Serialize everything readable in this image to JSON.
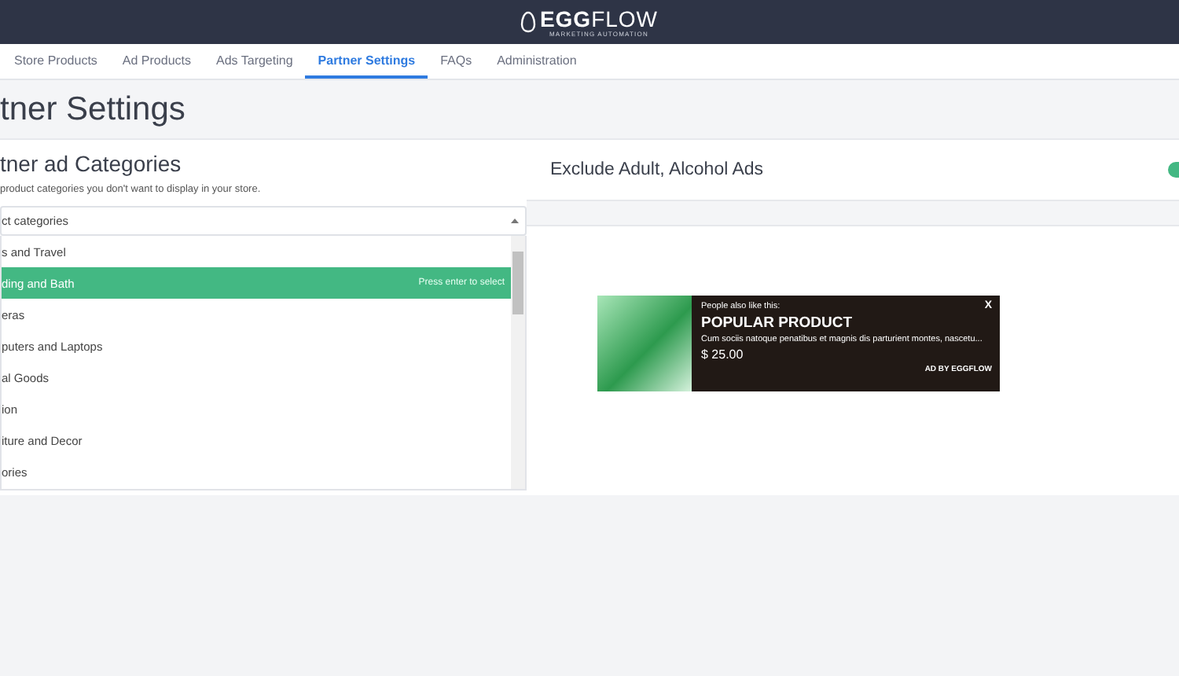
{
  "header": {
    "logo": "**EGG**FLOW",
    "tagline": "MARKETING AUTOMATION"
  },
  "tabs": [
    {
      "label": "Store Products",
      "selected": false
    },
    {
      "label": "Ad Products",
      "selected": false
    },
    {
      "label": "Ads Targeting",
      "selected": false
    },
    {
      "label": "Partner Settings",
      "selected": true
    },
    {
      "label": "FAQs",
      "selected": false
    },
    {
      "label": "Administration",
      "selected": false
    }
  ],
  "page_title": "tner Settings",
  "categories": {
    "title": "tner ad Categories",
    "description": "product categories you don't want to display in your store.",
    "placeholder": "ct categories",
    "hint": "Press enter to select",
    "options": [
      {
        "label": "s and Travel",
        "selected": false
      },
      {
        "label": "ding and Bath",
        "selected": true
      },
      {
        "label": "eras",
        "selected": false
      },
      {
        "label": "puters and Laptops",
        "selected": false
      },
      {
        "label": "al Goods",
        "selected": false
      },
      {
        "label": "ion",
        "selected": false
      },
      {
        "label": "iture and Decor",
        "selected": false
      },
      {
        "label": "ories",
        "selected": false
      }
    ]
  },
  "exclude": {
    "label": "Exclude Adult, Alcohol Ads",
    "on": true
  },
  "ad_preview": {
    "kicker": "People also like this:",
    "title": "POPULAR PRODUCT",
    "description": "Cum sociis natoque penatibus et magnis dis parturient montes, nascetu...",
    "price": "$ 25.00",
    "close": "X",
    "credit": "AD BY EGGFLOW"
  }
}
